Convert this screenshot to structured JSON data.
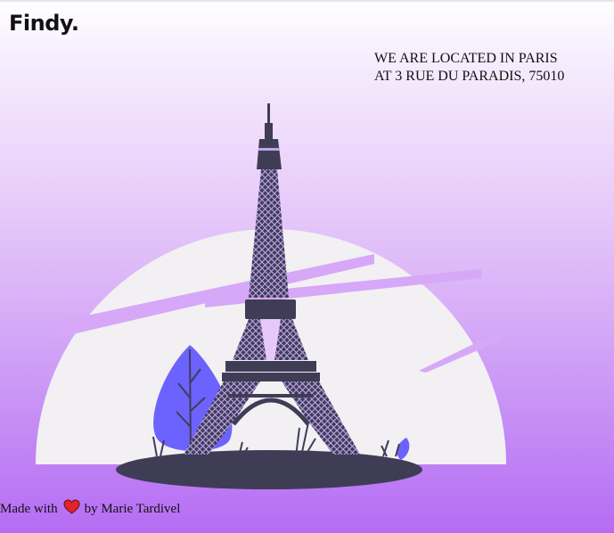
{
  "header": {
    "logo": "Findy."
  },
  "location": {
    "line1": "WE ARE LOCATED IN PARIS",
    "line2": "AT 3 RUE DU PARADIS, 75010"
  },
  "footer": {
    "prefix": "Made with",
    "suffix": "by Marie Tardivel",
    "heart_icon": "heart-icon",
    "heart_color": "#e0242a"
  },
  "illustration": {
    "subject": "eiffel-tower-icon",
    "colors": {
      "sun": "#f2f0f3",
      "tower": "#3f3d56",
      "leaf": "#6c63ff",
      "ground": "#3f3d56"
    }
  }
}
